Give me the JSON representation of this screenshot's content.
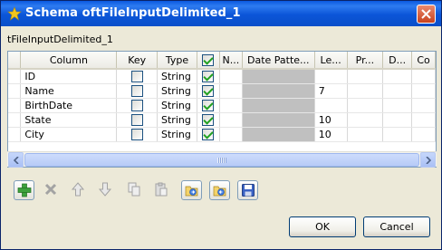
{
  "window": {
    "title": "Schema oftFileInputDelimited_1"
  },
  "component_label": "tFileInputDelimited_1",
  "table": {
    "headers": [
      "Column",
      "Key",
      "Type",
      "",
      "N...",
      "Date Patte...",
      "Le...",
      "Pr...",
      "D...",
      "Co"
    ],
    "header_check_checked": true,
    "rows": [
      {
        "column": "ID",
        "key": false,
        "type": "String",
        "nullable": true,
        "date_pattern": "",
        "length": ""
      },
      {
        "column": "Name",
        "key": false,
        "type": "String",
        "nullable": true,
        "date_pattern": "",
        "length": "7"
      },
      {
        "column": "BirthDate",
        "key": false,
        "type": "String",
        "nullable": true,
        "date_pattern": "",
        "length": ""
      },
      {
        "column": "State",
        "key": false,
        "type": "String",
        "nullable": true,
        "date_pattern": "",
        "length": "10"
      },
      {
        "column": "City",
        "key": false,
        "type": "String",
        "nullable": true,
        "date_pattern": "",
        "length": "10"
      }
    ]
  },
  "toolbar": {
    "icons": [
      "add-icon",
      "remove-icon",
      "move-up-icon",
      "move-down-icon",
      "copy-icon",
      "paste-icon",
      "import-schema-icon",
      "export-schema-icon",
      "save-icon"
    ]
  },
  "buttons": {
    "ok": "OK",
    "cancel": "Cancel"
  },
  "colors": {
    "titlebar": "#0a58e0",
    "accent_green": "#21a121",
    "dialog_bg": "#ece9d8"
  }
}
